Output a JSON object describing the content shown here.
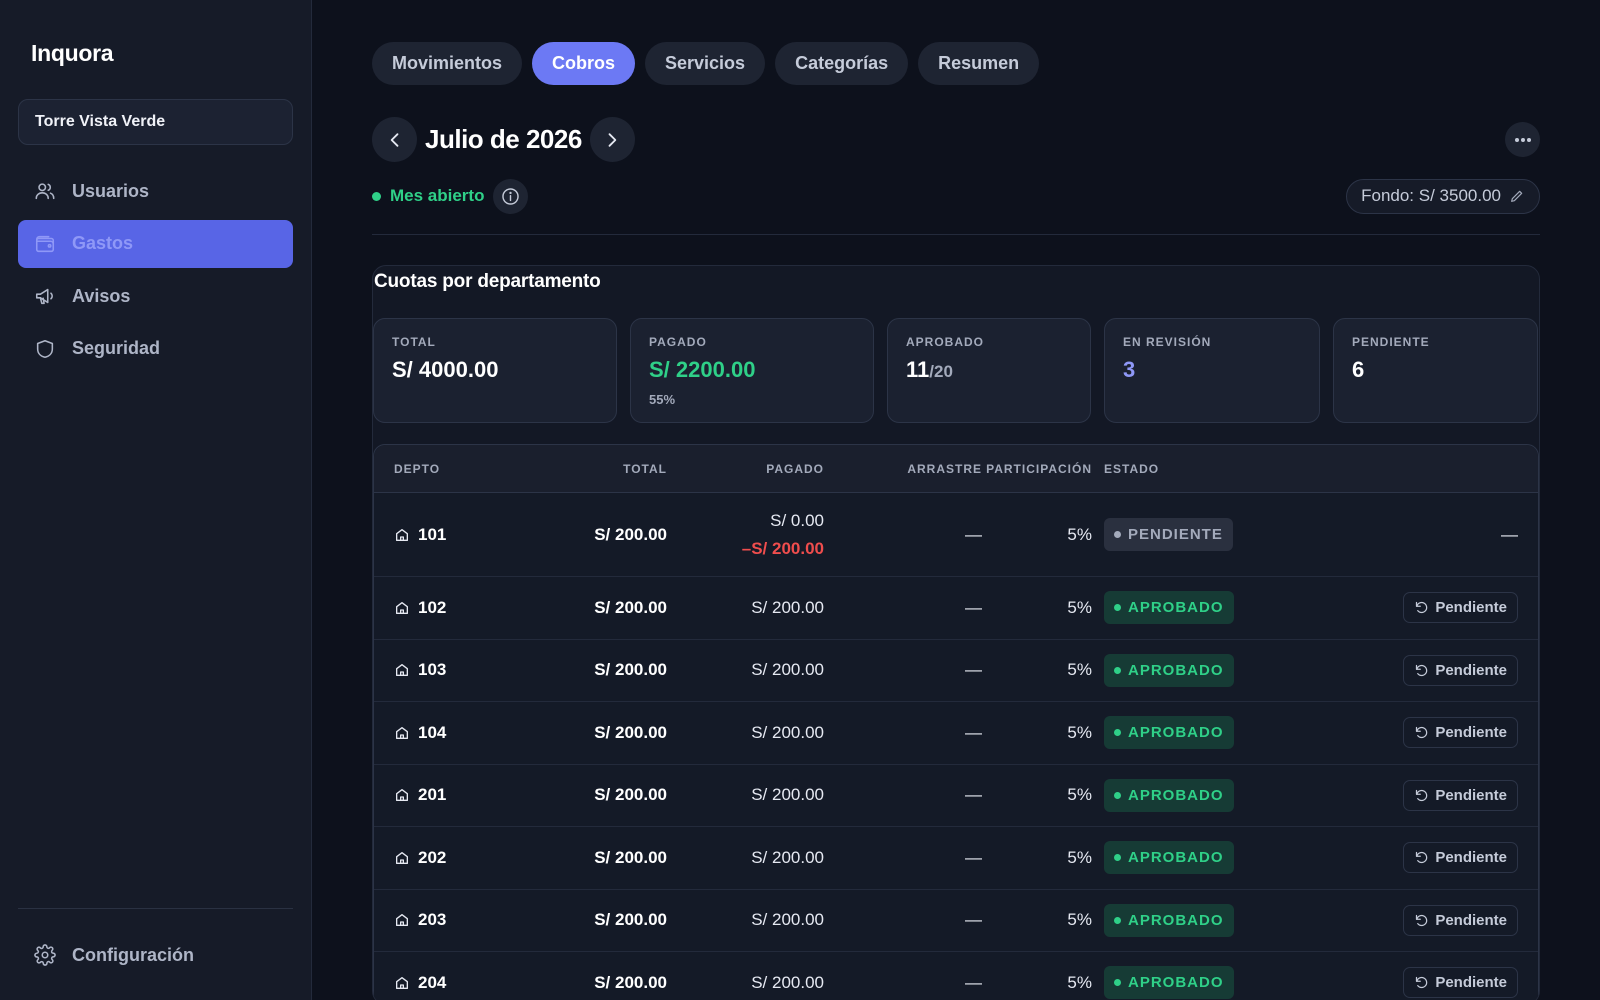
{
  "app": {
    "brand": "Inquora"
  },
  "sidebar": {
    "building": "Torre Vista Verde",
    "items": [
      {
        "label": "Usuarios",
        "icon": "users-icon"
      },
      {
        "label": "Gastos",
        "icon": "wallet-icon",
        "active": true
      },
      {
        "label": "Avisos",
        "icon": "megaphone-icon"
      },
      {
        "label": "Seguridad",
        "icon": "shield-icon"
      }
    ],
    "footer": {
      "label": "Configuración",
      "icon": "gear-icon"
    }
  },
  "tabs": [
    {
      "label": "Movimientos"
    },
    {
      "label": "Cobros",
      "active": true
    },
    {
      "label": "Servicios"
    },
    {
      "label": "Categorías"
    },
    {
      "label": "Resumen"
    }
  ],
  "period": {
    "title": "Julio de 2026"
  },
  "status": {
    "text": "Mes abierto",
    "color": "#2fd088"
  },
  "fund": {
    "label": "Fondo: S/ 3500.00"
  },
  "card": {
    "title": "Cuotas por departamento",
    "stats": {
      "total": {
        "label": "TOTAL",
        "value": "S/ 4000.00"
      },
      "pagado": {
        "label": "PAGADO",
        "value": "S/ 2200.00",
        "sub": "55%"
      },
      "aprobado": {
        "label": "APROBADO",
        "value": "11",
        "denominator": "/20"
      },
      "revision": {
        "label": "EN REVISIÓN",
        "value": "3"
      },
      "pendiente": {
        "label": "PENDIENTE",
        "value": "6"
      }
    }
  },
  "table": {
    "headers": {
      "depto": "DEPTO",
      "total": "TOTAL",
      "pagado": "PAGADO",
      "arrastre": "ARRASTRE",
      "participacion": "PARTICIPACIÓN",
      "estado": "ESTADO"
    },
    "rows": [
      {
        "depto": "101",
        "total": "S/ 200.00",
        "pagado": "S/ 0.00",
        "deuda": "–S/ 200.00",
        "arrastre": "—",
        "participacion": "5%",
        "estado": "PENDIENTE",
        "accion": "—"
      },
      {
        "depto": "102",
        "total": "S/ 200.00",
        "pagado": "S/ 200.00",
        "arrastre": "—",
        "participacion": "5%",
        "estado": "APROBADO",
        "accion": "Pendiente"
      },
      {
        "depto": "103",
        "total": "S/ 200.00",
        "pagado": "S/ 200.00",
        "arrastre": "—",
        "participacion": "5%",
        "estado": "APROBADO",
        "accion": "Pendiente"
      },
      {
        "depto": "104",
        "total": "S/ 200.00",
        "pagado": "S/ 200.00",
        "arrastre": "—",
        "participacion": "5%",
        "estado": "APROBADO",
        "accion": "Pendiente"
      },
      {
        "depto": "201",
        "total": "S/ 200.00",
        "pagado": "S/ 200.00",
        "arrastre": "—",
        "participacion": "5%",
        "estado": "APROBADO",
        "accion": "Pendiente"
      },
      {
        "depto": "202",
        "total": "S/ 200.00",
        "pagado": "S/ 200.00",
        "arrastre": "—",
        "participacion": "5%",
        "estado": "APROBADO",
        "accion": "Pendiente"
      },
      {
        "depto": "203",
        "total": "S/ 200.00",
        "pagado": "S/ 200.00",
        "arrastre": "—",
        "participacion": "5%",
        "estado": "APROBADO",
        "accion": "Pendiente"
      },
      {
        "depto": "204",
        "total": "S/ 200.00",
        "pagado": "S/ 200.00",
        "arrastre": "—",
        "participacion": "5%",
        "estado": "APROBADO",
        "accion": "Pendiente"
      }
    ]
  }
}
